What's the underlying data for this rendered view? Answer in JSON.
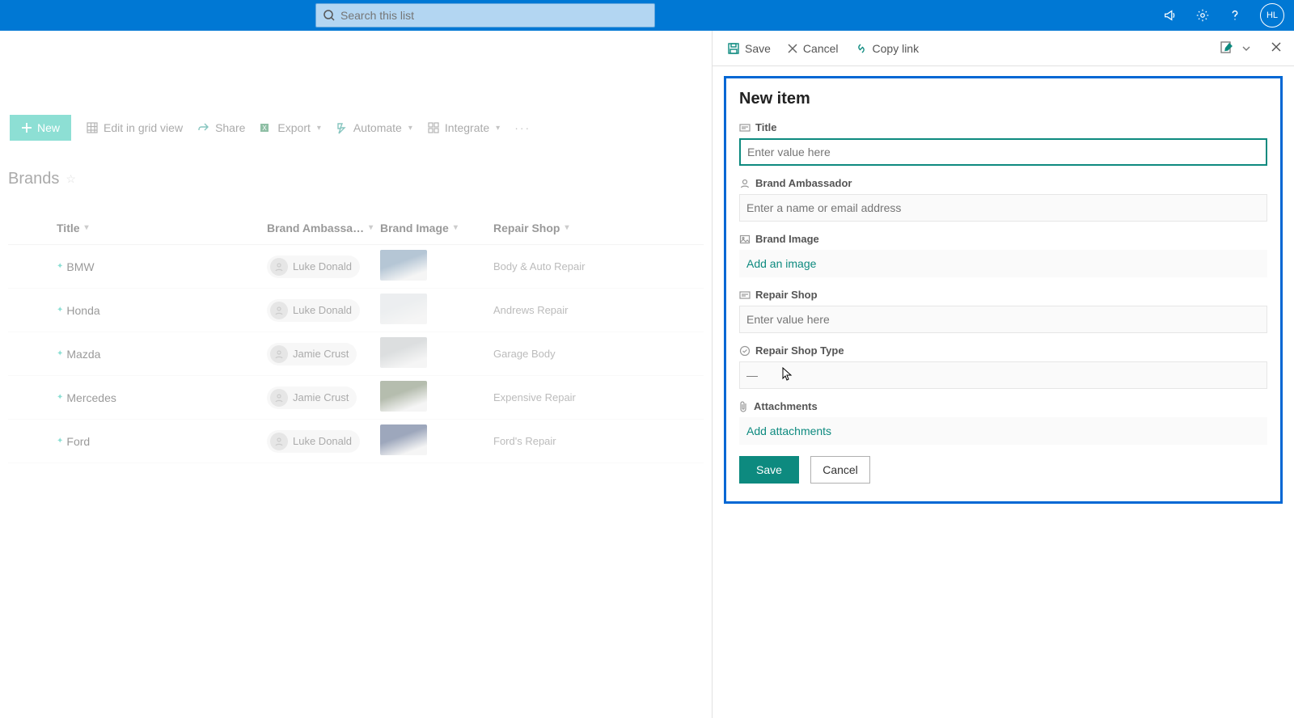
{
  "header": {
    "search_placeholder": "Search this list",
    "avatar_initials": "HL"
  },
  "commandbar": {
    "new_label": "New",
    "edit_grid_label": "Edit in grid view",
    "share_label": "Share",
    "export_label": "Export",
    "automate_label": "Automate",
    "integrate_label": "Integrate"
  },
  "list": {
    "title": "Brands",
    "columns": {
      "title": "Title",
      "ambassador": "Brand Ambassa…",
      "image": "Brand Image",
      "repair": "Repair Shop"
    },
    "rows": [
      {
        "title": "BMW",
        "person": "Luke Donald",
        "thumb": "#6a8caa",
        "repair": "Body & Auto Repair"
      },
      {
        "title": "Honda",
        "person": "Luke Donald",
        "thumb": "#d8dde0",
        "repair": "Andrews Repair"
      },
      {
        "title": "Mazda",
        "person": "Jamie Crust",
        "thumb": "#b8bdbf",
        "repair": "Garage Body"
      },
      {
        "title": "Mercedes",
        "person": "Jamie Crust",
        "thumb": "#6b7a5d",
        "repair": "Expensive Repair"
      },
      {
        "title": "Ford",
        "person": "Luke Donald",
        "thumb": "#3a4e78",
        "repair": "Ford's Repair"
      }
    ]
  },
  "panel": {
    "cmd": {
      "save": "Save",
      "cancel": "Cancel",
      "copy": "Copy link"
    },
    "form_title": "New item",
    "fields": {
      "title_label": "Title",
      "title_placeholder": "Enter value here",
      "ambassador_label": "Brand Ambassador",
      "ambassador_placeholder": "Enter a name or email address",
      "image_label": "Brand Image",
      "image_link": "Add an image",
      "repair_label": "Repair Shop",
      "repair_placeholder": "Enter value here",
      "repair_type_label": "Repair Shop Type",
      "repair_type_value": "—",
      "attachments_label": "Attachments",
      "attachments_link": "Add attachments"
    },
    "buttons": {
      "save": "Save",
      "cancel": "Cancel"
    }
  }
}
